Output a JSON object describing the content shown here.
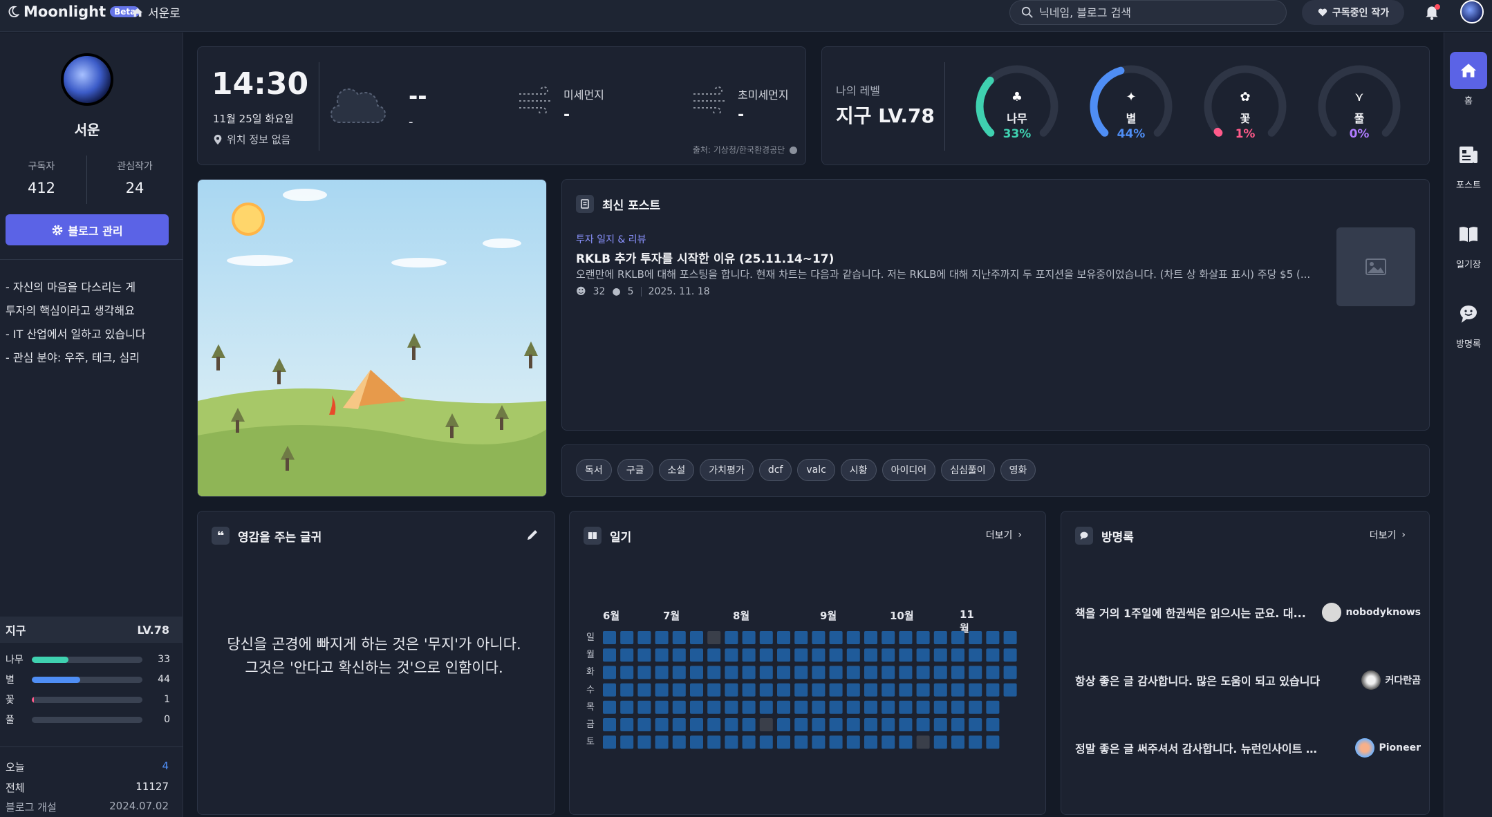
{
  "app": {
    "name": "Moonlight",
    "badge": "Beta",
    "crumb": "서운로"
  },
  "search": {
    "placeholder": "닉네임, 블로그 검색"
  },
  "header": {
    "subscribe_label": "구독중인 작가"
  },
  "profile": {
    "name": "서운",
    "subscribers_label": "구독자",
    "subscribers": "412",
    "interest_label": "관심작가",
    "interest": "24",
    "manage_label": "블로그 관리",
    "bio": [
      "- 자신의 마음을 다스리는 게",
      "투자의 핵심이라고 생각해요",
      "- IT 산업에서 일하고 있습니다",
      "- 관심 분야: 우주, 테크, 심리"
    ]
  },
  "side_level": {
    "name": "지구",
    "level": "LV.78",
    "items": [
      {
        "name": "나무",
        "value": "33",
        "pct": 33,
        "color": "#3fd1b0"
      },
      {
        "name": "별",
        "value": "44",
        "pct": 44,
        "color": "#4f8ef5"
      },
      {
        "name": "꽃",
        "value": "1",
        "pct": 1,
        "color": "#ff5a8a"
      },
      {
        "name": "풀",
        "value": "0",
        "pct": 0,
        "color": "#b07cff"
      }
    ]
  },
  "counts": {
    "today_label": "오늘",
    "today": "4",
    "total_label": "전체",
    "total": "11127",
    "open_label": "블로그 개설",
    "open": "2024.07.02"
  },
  "weather": {
    "time": "14:30",
    "date": "11월 25일 화요일",
    "location": "위치 정보 없음",
    "temp": "--",
    "temp_sub": "-",
    "dust_label": "미세먼지",
    "dust": "-",
    "ultra_label": "초미세먼지",
    "ultra": "-",
    "source": "출처: 기상청/한국환경공단"
  },
  "my_level": {
    "label": "나의 레벨",
    "level": "지구 LV.78",
    "gauges": [
      {
        "name": "나무",
        "pct": 33,
        "pct_label": "33%",
        "color": "#3fd1b0",
        "icon": "tree-icon"
      },
      {
        "name": "별",
        "pct": 44,
        "pct_label": "44%",
        "color": "#4f8ef5",
        "icon": "sparkle-icon"
      },
      {
        "name": "꽃",
        "pct": 1,
        "pct_label": "1%",
        "color": "#ff5a8a",
        "icon": "flower-icon"
      },
      {
        "name": "풀",
        "pct": 0,
        "pct_label": "0%",
        "color": "#b07cff",
        "icon": "grass-icon"
      }
    ]
  },
  "latest_post": {
    "title": "최신 포스트",
    "category": "투자 일지 & 리뷰",
    "post_title": "RKLB 추가 투자를 시작한 이유 (25.11.14~17)",
    "excerpt": "오랜만에 RKLB에 대해 포스팅을 합니다. 현재 차트는 다음과 같습니다. 저는 RKLB에 대해 지난주까지 두 포지션을 보유중이었습니다. (차트 상 화살표 표시) 주당 $5 (...",
    "likes": "32",
    "comments": "5",
    "date": "2025. 11. 18"
  },
  "tags": [
    "독서",
    "구글",
    "소설",
    "가치평가",
    "dcf",
    "valc",
    "시황",
    "아이디어",
    "심심풀이",
    "영화"
  ],
  "quote": {
    "title": "영감을 주는 글귀",
    "text": "당신을 곤경에 빠지게 하는 것은 '무지'가 아니다. 그것은 '안다고 확신하는 것'으로 인함이다."
  },
  "diary": {
    "title": "일기",
    "more": "더보기",
    "months": [
      "6월",
      "7월",
      "8월",
      "9월",
      "10월",
      "11월"
    ],
    "days": [
      "일",
      "월",
      "화",
      "수",
      "목",
      "금",
      "토"
    ]
  },
  "guestbook": {
    "title": "방명록",
    "more": "더보기",
    "entries": [
      {
        "text": "책을 거의 1주일에 한권씩은 읽으시는 군요. 대...",
        "user": "nobodyknows"
      },
      {
        "text": "항상 좋은 글 감사합니다. 많은 도움이 되고 있습니다",
        "user": "커다란곰"
      },
      {
        "text": "정말 좋은 글 써주셔서 감사합니다. 뉴런인사이트 선정...",
        "user": "Pioneer"
      }
    ]
  },
  "rightnav": {
    "home": "홈",
    "posts": "포스트",
    "diary": "일기장",
    "guestbook": "방명록"
  },
  "colors": {
    "accent": "#5b63e6",
    "cell": "#1f5b9a",
    "cell_empty": "#3a3f4a"
  }
}
